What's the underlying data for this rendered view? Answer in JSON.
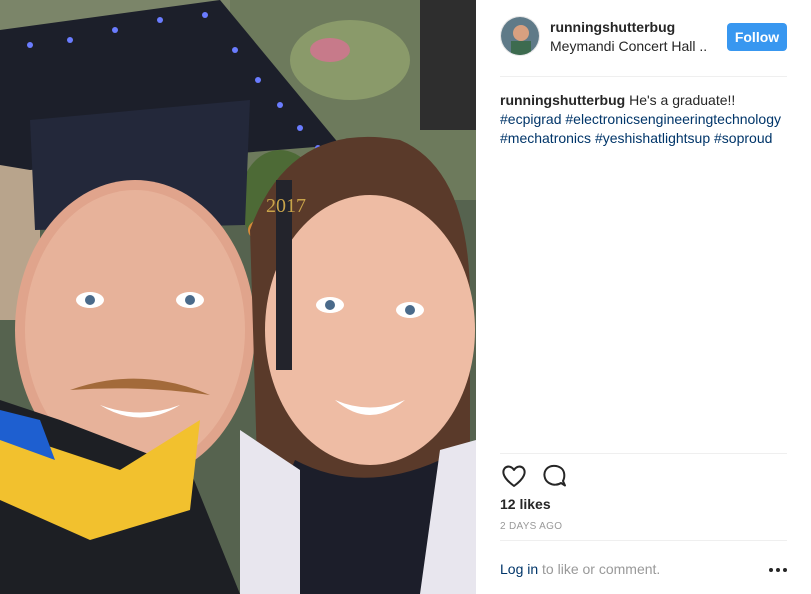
{
  "post": {
    "photo_icon": "selfie-photo",
    "header": {
      "avatar_icon": "profile-avatar",
      "username": "runningshutterbug",
      "location": "Meymandi Concert Hall ..",
      "follow_label": "Follow"
    },
    "caption": {
      "username": "runningshutterbug",
      "text": " He's a graduate!!",
      "hashtags": [
        "#ecpigrad",
        "#electronicsengineeringtechnology",
        "#mechatronics",
        "#yeshishatlightsup",
        "#soproud"
      ]
    },
    "actions": {
      "like_icon": "heart-icon",
      "comment_icon": "comment-icon"
    },
    "likes": "12 likes",
    "timestamp": "2 DAYS AGO",
    "footer": {
      "login_link": "Log in",
      "login_suffix": " to like or comment.",
      "more_icon": "more-options-icon"
    },
    "colors": {
      "follow_button": "#3897f0",
      "hashtag": "#003569",
      "muted": "#999999",
      "text": "#262626"
    }
  }
}
